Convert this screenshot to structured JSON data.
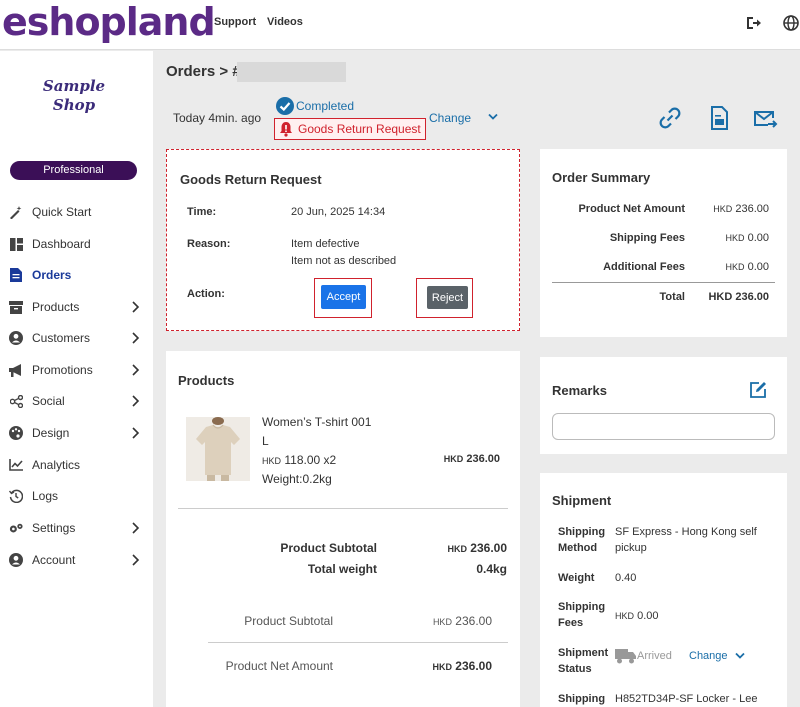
{
  "topbar": {
    "logo": "eshopland",
    "nav": [
      "Support",
      "Videos"
    ]
  },
  "sidebar": {
    "shop_logo": "Sample Shop",
    "plan": "Professional",
    "items": [
      {
        "label": "Quick Start"
      },
      {
        "label": "Dashboard"
      },
      {
        "label": "Orders"
      },
      {
        "label": "Products"
      },
      {
        "label": "Customers"
      },
      {
        "label": "Promotions"
      },
      {
        "label": "Social"
      },
      {
        "label": "Design"
      },
      {
        "label": "Analytics"
      },
      {
        "label": "Logs"
      },
      {
        "label": "Settings"
      },
      {
        "label": "Account"
      }
    ]
  },
  "header": {
    "breadcrumb": "Orders > #",
    "time_ago": "Today 4min. ago",
    "status_completed": "Completed",
    "status_return": "Goods Return Request",
    "change_label": "Change"
  },
  "return_request": {
    "title": "Goods Return Request",
    "time_label": "Time:",
    "time_value": "20 Jun, 2025 14:34",
    "reason_label": "Reason:",
    "reason_line1": "Item defective",
    "reason_line2": "Item not as described",
    "action_label": "Action:",
    "accept_label": "Accept",
    "reject_label": "Reject"
  },
  "order_summary": {
    "title": "Order Summary",
    "rows": [
      {
        "label": "Product Net Amount",
        "currency": "HKD",
        "amount": "236.00"
      },
      {
        "label": "Shipping Fees",
        "currency": "HKD",
        "amount": "0.00"
      },
      {
        "label": "Additional Fees",
        "currency": "HKD",
        "amount": "0.00"
      }
    ],
    "total_label": "Total",
    "total_value": "HKD 236.00"
  },
  "products": {
    "title": "Products",
    "item": {
      "name": "Women’s T-shirt 001",
      "size": "L",
      "currency": "HKD",
      "price_qty": "118.00 x2",
      "weight": "Weight:0.2kg",
      "line_total_currency": "HKD",
      "line_total": "236.00"
    },
    "subtotal_label": "Product Subtotal",
    "subtotal_currency": "HKD",
    "subtotal_value": "236.00",
    "weight_label": "Total weight",
    "weight_value": "0.4kg",
    "summary_subtotal_label": "Product Subtotal",
    "summary_subtotal_currency": "HKD",
    "summary_subtotal_value": "236.00",
    "net_amount_label": "Product Net Amount",
    "net_amount_currency": "HKD",
    "net_amount_value": "236.00"
  },
  "remarks": {
    "title": "Remarks",
    "value": ""
  },
  "shipment": {
    "title": "Shipment",
    "method_label": "Shipping Method",
    "method_value": "SF Express - Hong Kong self pickup",
    "weight_label": "Weight",
    "weight_value": "0.40",
    "fees_label": "Shipping Fees",
    "fees_currency": "HKD",
    "fees_value": "0.00",
    "status_label": "Shipment Status",
    "status_value": "Arrived",
    "status_change": "Change",
    "shipping_label": "Shipping",
    "shipping_value": "H852TD34P-SF Locker - Lee"
  },
  "colors": {
    "brand": "#5b2a86",
    "accent_red": "#d0222d",
    "link_blue": "#1a6ea8",
    "accept_blue": "#1a73e8",
    "reject_gray": "#5a6268"
  }
}
